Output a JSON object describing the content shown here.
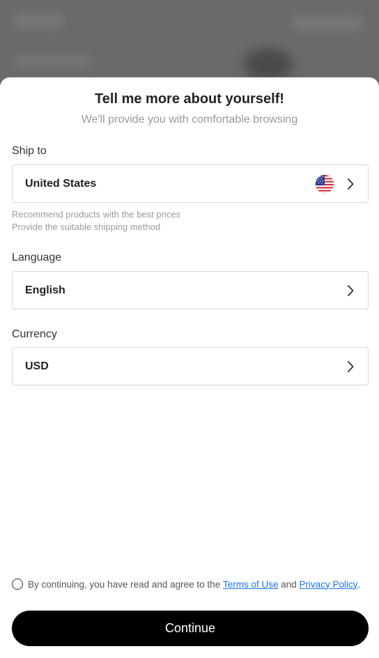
{
  "sheet": {
    "title": "Tell me more about yourself!",
    "subtitle": "We'll provide you with comfortable browsing"
  },
  "ship_to": {
    "label": "Ship to",
    "value": "United States",
    "flag_icon": "us-flag-icon",
    "hint_line1": "Recommend products with the best prices",
    "hint_line2": "Provide the suitable shipping method"
  },
  "language": {
    "label": "Language",
    "value": "English"
  },
  "currency": {
    "label": "Currency",
    "value": "USD"
  },
  "agreement": {
    "prefix": "By continuing, you have read and agree to the ",
    "terms": "Terms of Use",
    "and": " and ",
    "privacy": "Privacy Policy",
    "suffix": "."
  },
  "continue_label": "Continue",
  "colors": {
    "link": "#1a73e8",
    "button_bg": "#000000",
    "hint_text": "#9a9a9a"
  }
}
